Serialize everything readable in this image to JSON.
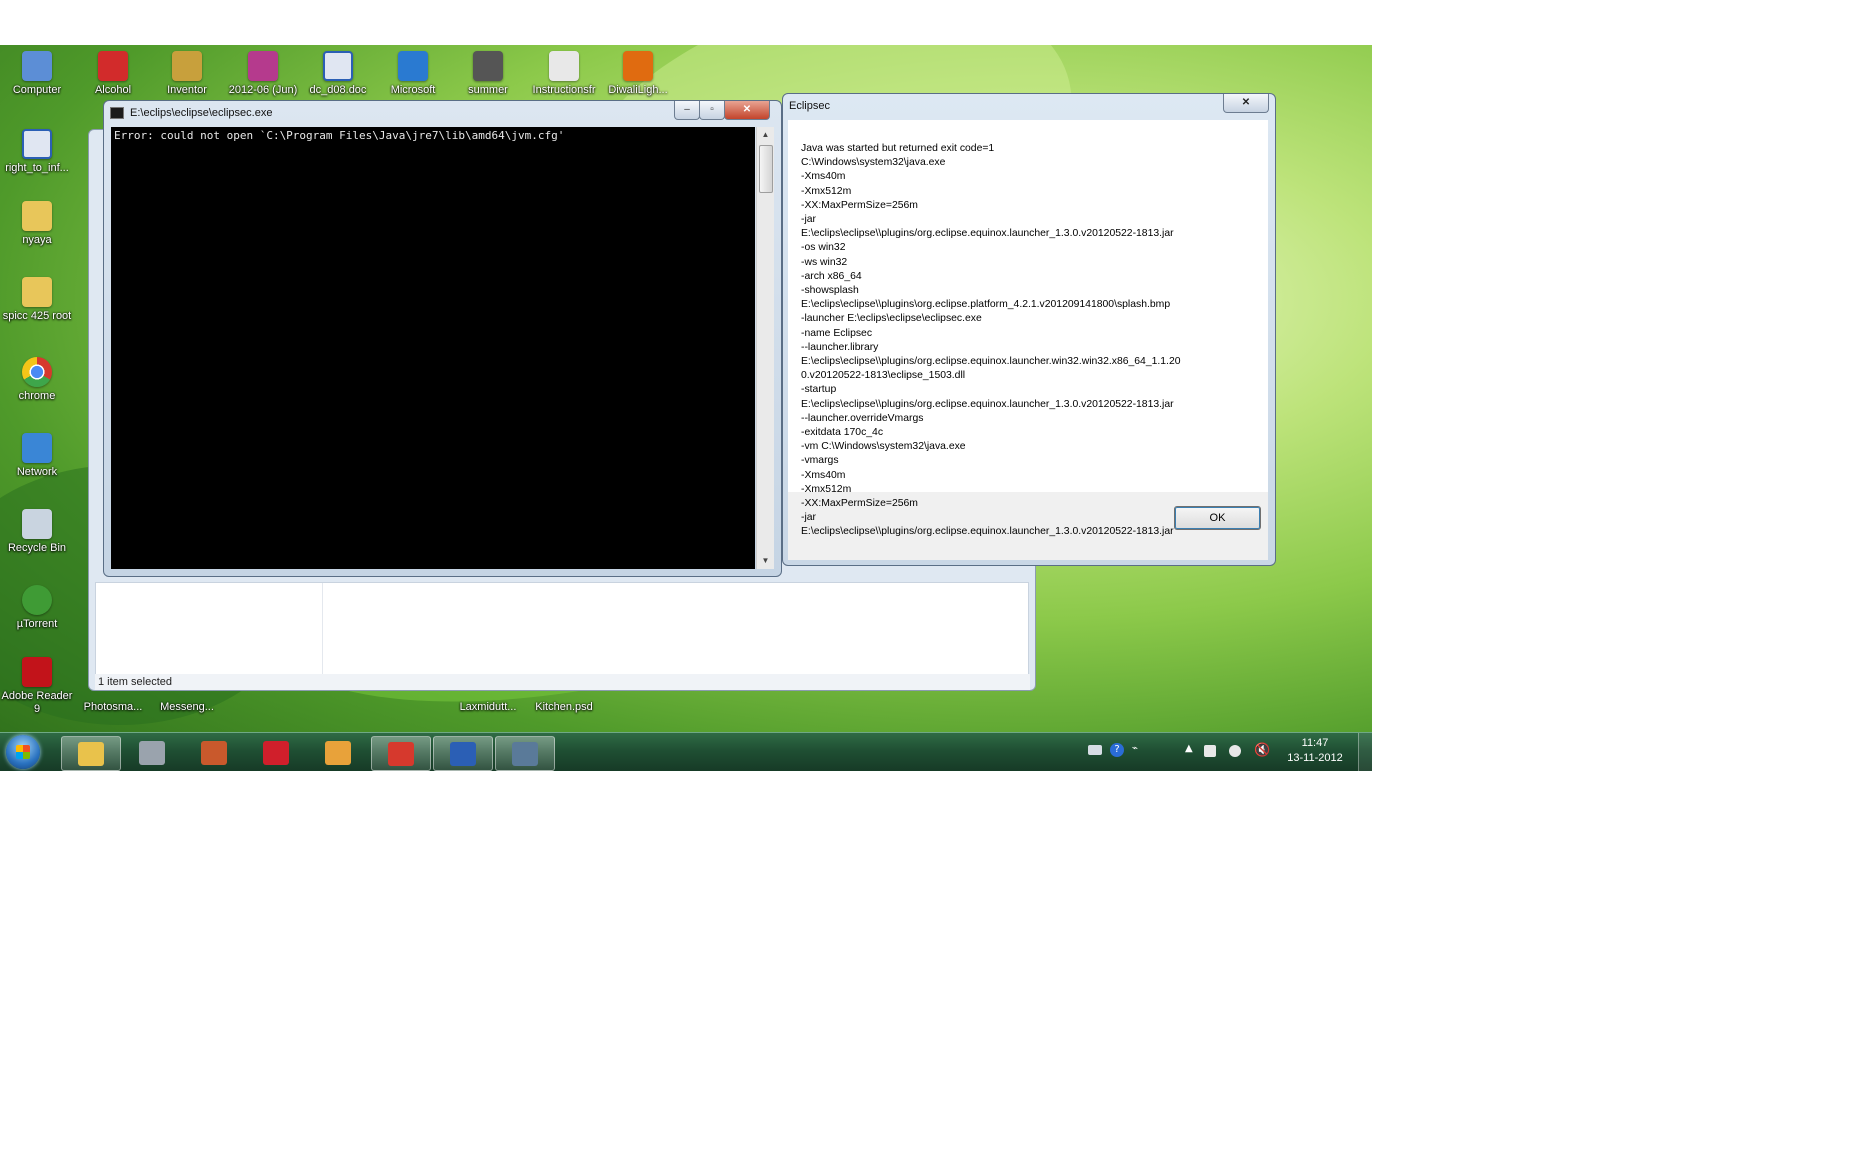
{
  "desktop": {
    "icons": [
      {
        "label": "Computer",
        "icon": "computer-icon",
        "color": "#5c8ed6"
      },
      {
        "label": "Alcohol",
        "icon": "alcohol-icon",
        "color": "#d22b2b"
      },
      {
        "label": "Inventor",
        "icon": "inventor-icon",
        "color": "#c8a03c"
      },
      {
        "label": "2012-06 (Jun)",
        "icon": "archive-icon",
        "color": "#b53a8d"
      },
      {
        "label": "dc_d08.doc",
        "icon": "word-doc-icon",
        "color": "#2b5fb5"
      },
      {
        "label": "Microsoft",
        "icon": "microsoft-icon",
        "color": "#2a7ad1"
      },
      {
        "label": "summer",
        "icon": "image-file-icon",
        "color": "#555555"
      },
      {
        "label": "Instructionsfr",
        "icon": "docx-file-icon",
        "color": "#e8e8e8"
      },
      {
        "label": "DiwaliLigh...",
        "icon": "image-file-icon",
        "color": "#e06b10"
      },
      {
        "label": "right_to_inf...",
        "icon": "word-doc-icon",
        "color": "#e0e6f2"
      },
      {
        "label": "nyaya",
        "icon": "folder-icon",
        "color": "#e8c65a"
      },
      {
        "label": "spicc 425 root",
        "icon": "folder-icon",
        "color": "#e8c65a"
      },
      {
        "label": "chrome",
        "icon": "chrome-icon",
        "color": "#d6392d"
      },
      {
        "label": "Network",
        "icon": "network-icon",
        "color": "#3a86d6"
      },
      {
        "label": "Recycle Bin",
        "icon": "recycle-bin-icon",
        "color": "#c9d4e0"
      },
      {
        "label": "µTorrent",
        "icon": "utorrent-icon",
        "color": "#3f9b35"
      },
      {
        "label": "Adobe Reader 9",
        "icon": "adobe-reader-icon",
        "color": "#c2131a"
      }
    ],
    "partial_labels": [
      "Photosma...",
      "Messeng...",
      "Laxmidutt...",
      "Kitchen.psd"
    ]
  },
  "explorer_behind": {
    "status": "1 item selected"
  },
  "console_window": {
    "title": "E:\\eclips\\eclipse\\eclipsec.exe",
    "output": "Error: could not open `C:\\Program Files\\Java\\jre7\\lib\\amd64\\jvm.cfg'"
  },
  "dialog": {
    "title": "Eclipsec",
    "lines": [
      "Java was started but returned exit code=1",
      "C:\\Windows\\system32\\java.exe",
      "-Xms40m",
      "-Xmx512m",
      "-XX:MaxPermSize=256m",
      "-jar",
      "E:\\eclips\\eclipse\\\\plugins/org.eclipse.equinox.launcher_1.3.0.v20120522-1813.jar",
      "-os win32",
      "-ws win32",
      "-arch x86_64",
      "-showsplash",
      "E:\\eclips\\eclipse\\\\plugins\\org.eclipse.platform_4.2.1.v201209141800\\splash.bmp",
      "-launcher E:\\eclips\\eclipse\\eclipsec.exe",
      "-name Eclipsec",
      "--launcher.library",
      "E:\\eclips\\eclipse\\\\plugins/org.eclipse.equinox.launcher.win32.win32.x86_64_1.1.20",
      "0.v20120522-1813\\eclipse_1503.dll",
      "-startup",
      "E:\\eclips\\eclipse\\\\plugins/org.eclipse.equinox.launcher_1.3.0.v20120522-1813.jar",
      "--launcher.overrideVmargs",
      "-exitdata 170c_4c",
      "-vm C:\\Windows\\system32\\java.exe",
      "-vmargs",
      "-Xms40m",
      "-Xmx512m",
      "-XX:MaxPermSize=256m",
      "-jar",
      "E:\\eclips\\eclipse\\\\plugins/org.eclipse.equinox.launcher_1.3.0.v20120522-1813.jar"
    ],
    "ok_label": "OK"
  },
  "taskbar": {
    "time": "11:47",
    "date": "13-11-2012",
    "apps": [
      {
        "icon": "explorer-icon",
        "color": "#e9c24b",
        "active": true
      },
      {
        "icon": "computer-icon",
        "color": "#9aa3ad",
        "active": false
      },
      {
        "icon": "game-icon",
        "color": "#c9592c",
        "active": false
      },
      {
        "icon": "need-for-speed-icon",
        "color": "#d01f2b",
        "active": false
      },
      {
        "icon": "word-icon",
        "color": "#e8a23a",
        "active": false
      },
      {
        "icon": "chrome-icon",
        "color": "#d6392d",
        "active": true
      },
      {
        "icon": "ms-word-icon",
        "color": "#2b5fb5",
        "active": true
      },
      {
        "icon": "console-icon",
        "color": "#5a7a99",
        "active": true
      }
    ]
  }
}
